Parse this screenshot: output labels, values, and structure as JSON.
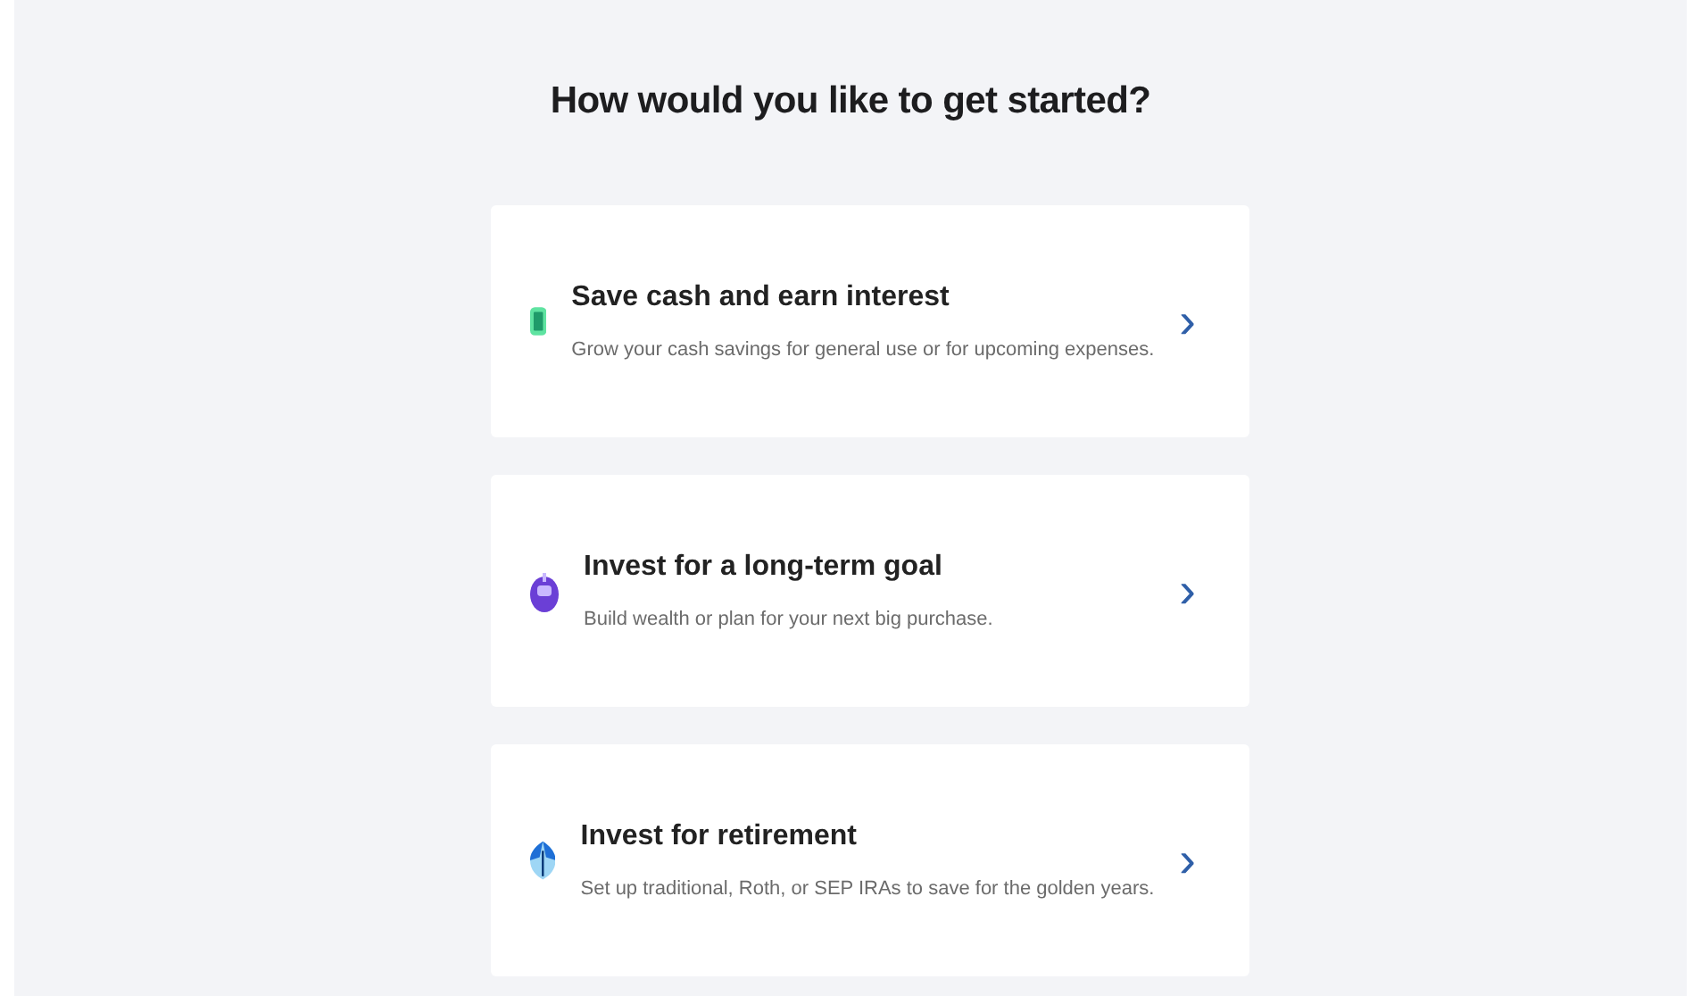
{
  "heading": "How would you like to get started?",
  "options": [
    {
      "kind": "cash",
      "title": "Save cash and earn interest",
      "description": "Grow your cash savings for general use or for upcoming expenses.",
      "chevron": "›"
    },
    {
      "kind": "invest",
      "title": "Invest for a long-term goal",
      "description": "Build wealth or plan for your next big purchase.",
      "chevron": "›"
    },
    {
      "kind": "retirement",
      "title": "Invest for retirement",
      "description": "Set up traditional, Roth, or SEP IRAs to save for the golden years.",
      "chevron": "›"
    }
  ]
}
